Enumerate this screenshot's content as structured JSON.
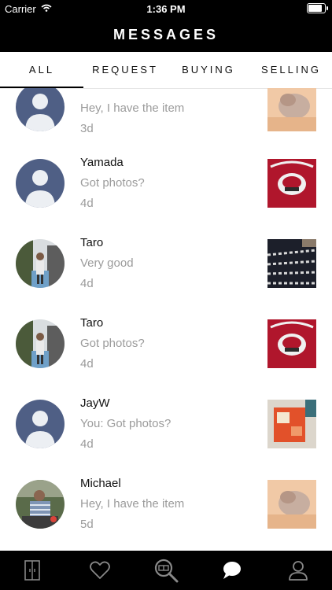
{
  "status_bar": {
    "carrier": "Carrier",
    "time": "1:36 PM",
    "battery_level": 0.95
  },
  "header": {
    "title": "MESSAGES"
  },
  "tabs": [
    {
      "label": "ALL",
      "selected": true
    },
    {
      "label": "REQUEST",
      "selected": false
    },
    {
      "label": "BUYING",
      "selected": false
    },
    {
      "label": "SELLING",
      "selected": false
    }
  ],
  "conversations": [
    {
      "name": "",
      "message": "Hey, I have the item",
      "date": "3d",
      "avatar": "default-avatar",
      "thumbnail": "cat-photo"
    },
    {
      "name": "Yamada",
      "message": "Got photos?",
      "date": "4d",
      "avatar": "default-avatar",
      "thumbnail": "red-shirt-photo"
    },
    {
      "name": "Taro",
      "message": "Very good",
      "date": "4d",
      "avatar": "person-photo",
      "thumbnail": "striped-fabric-photo"
    },
    {
      "name": "Taro",
      "message": "Got photos?",
      "date": "4d",
      "avatar": "person-photo",
      "thumbnail": "red-shirt-photo"
    },
    {
      "name": "JayW",
      "message": "You: Got photos?",
      "date": "4d",
      "avatar": "default-avatar",
      "thumbnail": "package-photo"
    },
    {
      "name": "Michael",
      "message": "Hey, I have the item",
      "date": "5d",
      "avatar": "child-photo",
      "thumbnail": "cat-photo"
    }
  ],
  "tab_bar": {
    "items": [
      {
        "icon": "closet-icon",
        "selected": false
      },
      {
        "icon": "heart-icon",
        "selected": false
      },
      {
        "icon": "search-icon",
        "selected": false
      },
      {
        "icon": "chat-bubble-icon",
        "selected": true
      },
      {
        "icon": "profile-icon",
        "selected": false
      }
    ]
  },
  "colors": {
    "bar_background": "#000000",
    "secondary_text": "#9b9b9b",
    "avatar_blue": "#4f5f85"
  }
}
